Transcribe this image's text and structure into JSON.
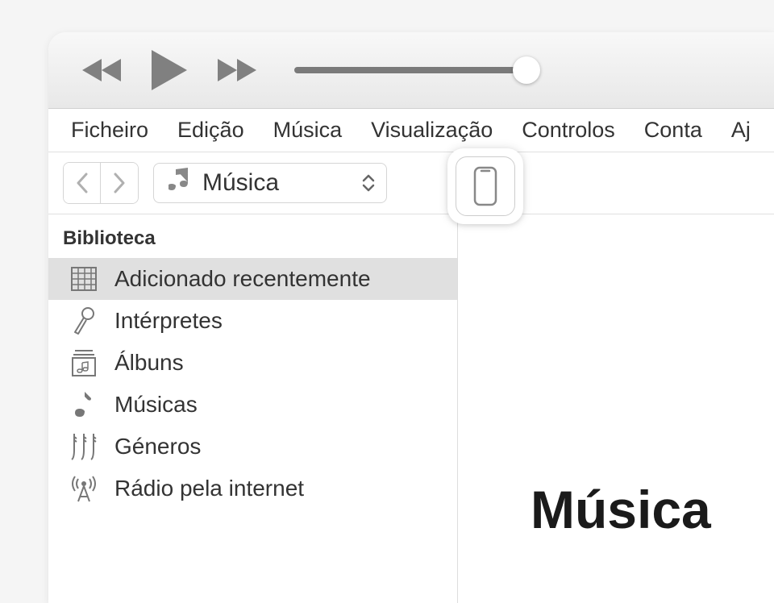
{
  "menubar": {
    "items": [
      "Ficheiro",
      "Edição",
      "Música",
      "Visualização",
      "Controlos",
      "Conta",
      "Aj"
    ]
  },
  "toolbar": {
    "media_selector": "Música"
  },
  "sidebar": {
    "header": "Biblioteca",
    "items": [
      {
        "label": "Adicionado recentemente",
        "icon": "grid",
        "selected": true
      },
      {
        "label": "Intérpretes",
        "icon": "microphone",
        "selected": false
      },
      {
        "label": "Álbuns",
        "icon": "album",
        "selected": false
      },
      {
        "label": "Músicas",
        "icon": "note",
        "selected": false
      },
      {
        "label": "Géneros",
        "icon": "guitar",
        "selected": false
      },
      {
        "label": "Rádio pela internet",
        "icon": "antenna",
        "selected": false
      }
    ]
  },
  "main": {
    "title": "Música"
  },
  "player": {
    "volume": 100
  }
}
